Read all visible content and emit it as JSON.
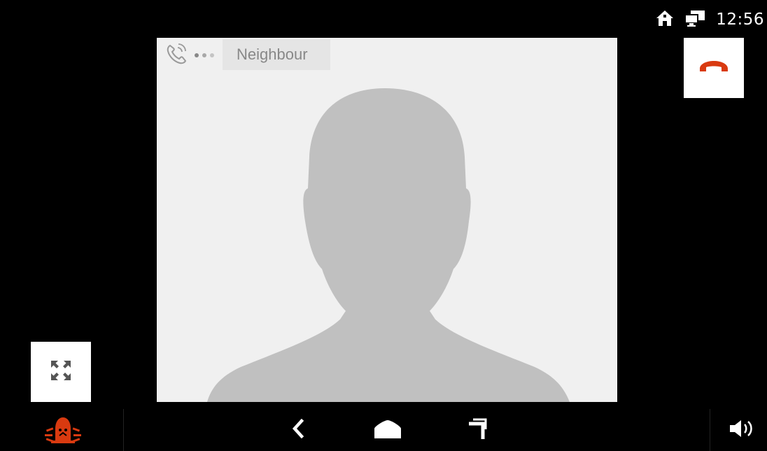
{
  "status_bar": {
    "time": "12:56",
    "icons": [
      "home-icon",
      "network-icon"
    ]
  },
  "call": {
    "caller_name": "Neighbour",
    "status_icon": "phone-ringing-icon",
    "end_call_icon": "hang-up-icon"
  },
  "controls": {
    "fullscreen_icon": "expand-icon"
  },
  "nav_bar": {
    "icons": [
      "alarm-icon",
      "back-icon",
      "home-icon",
      "recents-icon",
      "volume-icon"
    ]
  },
  "colors": {
    "accent": "#d93a10",
    "background": "#000000",
    "video_bg": "#f0f0f0",
    "silhouette": "#c0c0c0"
  }
}
